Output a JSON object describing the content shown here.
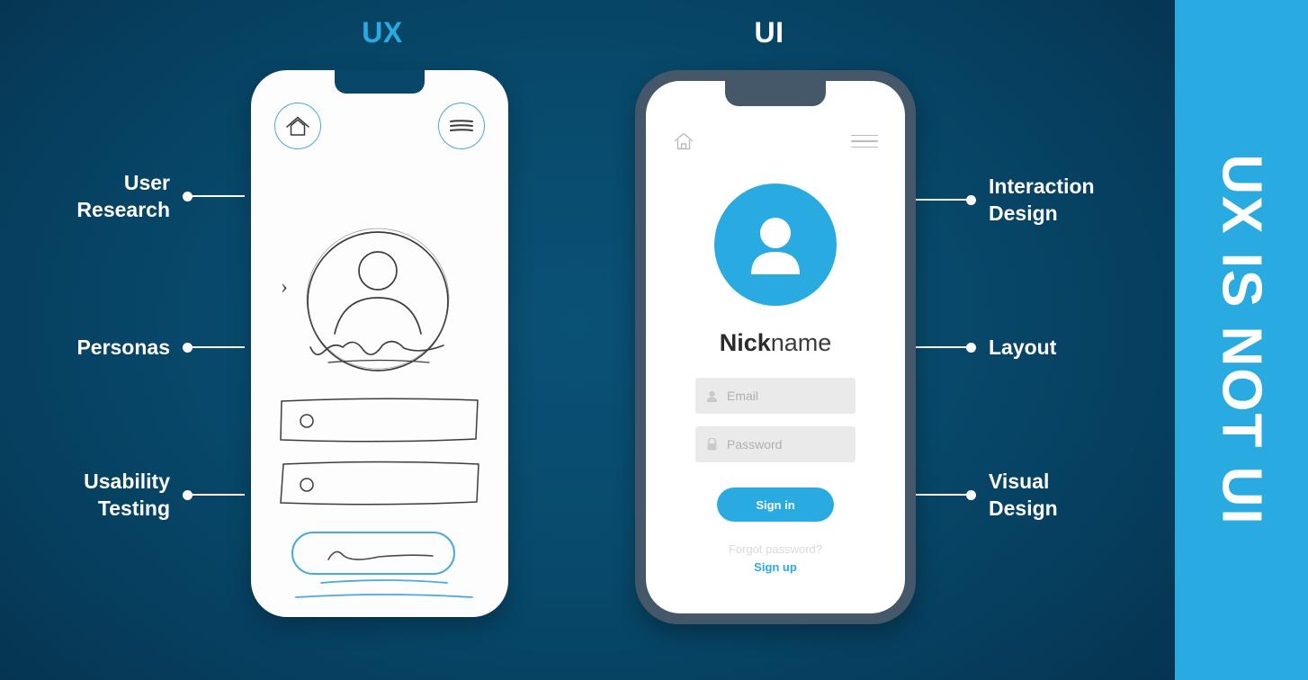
{
  "headings": {
    "ux": "UX",
    "ui": "UI"
  },
  "side_band": {
    "text": "UX IS NOT UI",
    "color": "#29abe2"
  },
  "left_labels": [
    {
      "text": "User\nResearch",
      "name": "user-research"
    },
    {
      "text": "Personas",
      "name": "personas"
    },
    {
      "text": "Usability\nTesting",
      "name": "usability-testing"
    }
  ],
  "right_labels": [
    {
      "text": "Interaction\nDesign",
      "name": "interaction-design"
    },
    {
      "text": "Layout",
      "name": "layout"
    },
    {
      "text": "Visual\nDesign",
      "name": "visual-design"
    }
  ],
  "ux_phone": {
    "home_icon": "home-icon",
    "menu_icon": "hamburger-menu-icon",
    "chevron": "›",
    "avatar_icon": "user-avatar-sketch",
    "accent": "#4aa8dd"
  },
  "ui_phone": {
    "home_icon": "home-icon",
    "menu_icon": "hamburger-menu-icon",
    "nickname_bold": "Nick",
    "nickname_light": "name",
    "email_placeholder": "Email",
    "password_placeholder": "Password",
    "signin_label": "Sign in",
    "forgot_label": "Forgot password?",
    "signup_label": "Sign up",
    "accent": "#29abe2",
    "frame_color": "#44586a"
  },
  "theme": {
    "background_dark": "#063f5f",
    "background_light": "#0a5176",
    "white": "#ffffff"
  }
}
